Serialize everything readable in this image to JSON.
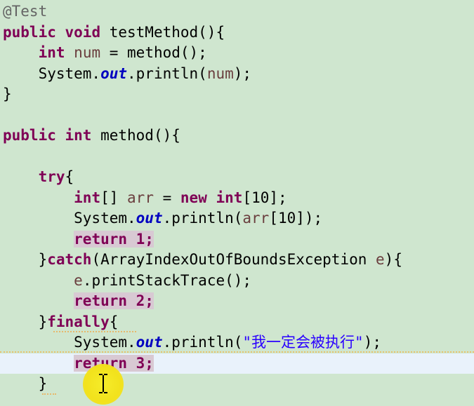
{
  "editor": {
    "lines": [
      [
        {
          "t": "@Test",
          "c": "ann"
        }
      ],
      [
        {
          "t": "public",
          "c": "kw"
        },
        {
          "t": " "
        },
        {
          "t": "void",
          "c": "kw"
        },
        {
          "t": " testMethod(){"
        }
      ],
      [
        {
          "t": "    "
        },
        {
          "t": "int",
          "c": "kw"
        },
        {
          "t": " "
        },
        {
          "t": "num",
          "c": "var"
        },
        {
          "t": " = method();"
        }
      ],
      [
        {
          "t": "    System."
        },
        {
          "t": "out",
          "c": "field"
        },
        {
          "t": ".println("
        },
        {
          "t": "num",
          "c": "var"
        },
        {
          "t": ");"
        }
      ],
      [
        {
          "t": "}"
        }
      ],
      [
        {
          "t": ""
        }
      ],
      [
        {
          "t": "public",
          "c": "kw"
        },
        {
          "t": " "
        },
        {
          "t": "int",
          "c": "kw"
        },
        {
          "t": " method(){"
        }
      ],
      [
        {
          "t": ""
        }
      ],
      [
        {
          "t": "    "
        },
        {
          "t": "try",
          "c": "kw"
        },
        {
          "t": "{"
        }
      ],
      [
        {
          "t": "        "
        },
        {
          "t": "int",
          "c": "kw"
        },
        {
          "t": "[] "
        },
        {
          "t": "arr",
          "c": "var"
        },
        {
          "t": " = "
        },
        {
          "t": "new",
          "c": "kw"
        },
        {
          "t": " "
        },
        {
          "t": "int",
          "c": "kw"
        },
        {
          "t": "[10];"
        }
      ],
      [
        {
          "t": "        System."
        },
        {
          "t": "out",
          "c": "field"
        },
        {
          "t": ".println("
        },
        {
          "t": "arr",
          "c": "var"
        },
        {
          "t": "[10]);"
        }
      ],
      [
        {
          "t": "        "
        },
        {
          "t": "return 1;",
          "c": "kw ret-bg"
        }
      ],
      [
        {
          "t": "    }"
        },
        {
          "t": "catch",
          "c": "kw"
        },
        {
          "t": "(ArrayIndexOutOfBoundsException "
        },
        {
          "t": "e",
          "c": "var"
        },
        {
          "t": "){"
        }
      ],
      [
        {
          "t": "        "
        },
        {
          "t": "e",
          "c": "var"
        },
        {
          "t": ".printStackTrace();"
        }
      ],
      [
        {
          "t": "        "
        },
        {
          "t": "return 2;",
          "c": "kw ret-bg"
        }
      ],
      [
        {
          "t": "    }"
        },
        {
          "t": "finally",
          "c": "kw"
        },
        {
          "t": "{"
        }
      ],
      [
        {
          "t": "        System."
        },
        {
          "t": "out",
          "c": "field"
        },
        {
          "t": ".println("
        },
        {
          "t": "\"我一定会被执行\"",
          "c": "str"
        },
        {
          "t": ");"
        }
      ],
      [
        {
          "t": "        "
        },
        {
          "t": "return 3;",
          "c": "kw ret-bg"
        }
      ],
      [
        {
          "t": "    }"
        }
      ]
    ],
    "current_line_index": 17
  }
}
